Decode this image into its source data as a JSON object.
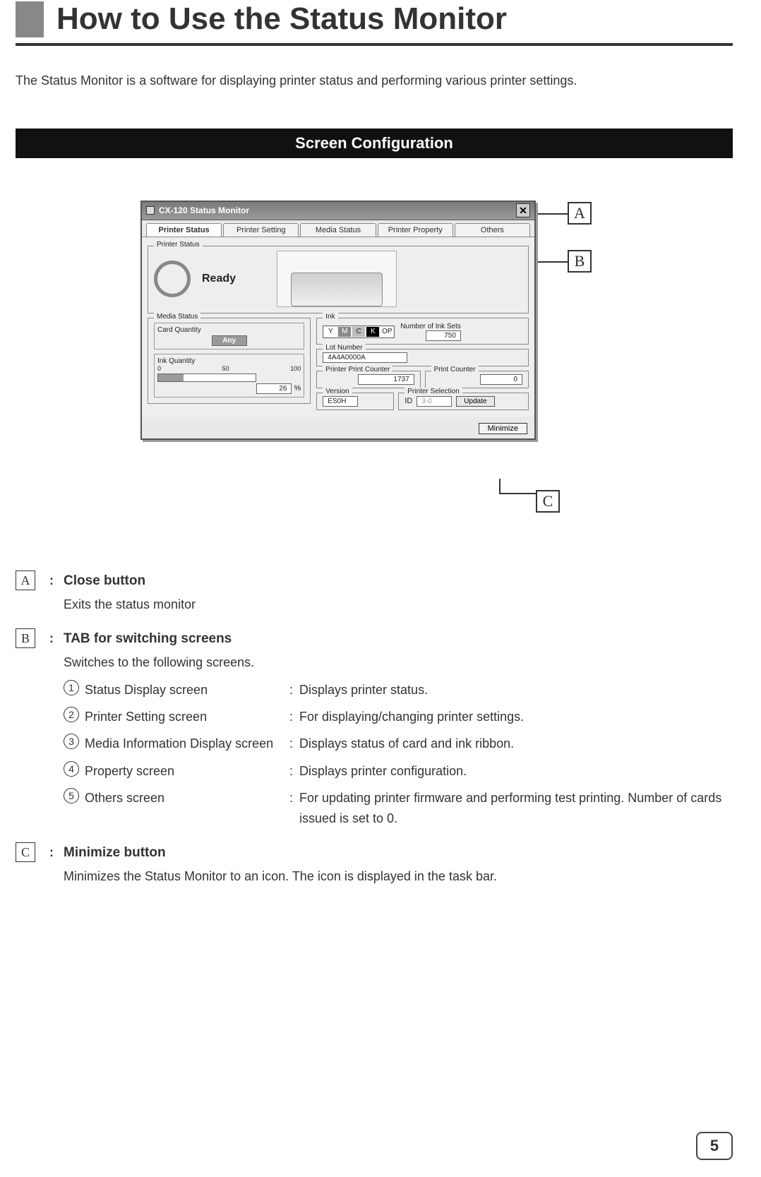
{
  "page_title": "How to Use the Status Monitor",
  "intro": "The Status Monitor is a software for displaying printer status and performing various printer settings.",
  "section_head": "Screen Configuration",
  "app": {
    "window_title": "CX-120 Status Monitor",
    "close_glyph": "✕",
    "tabs": {
      "t1": "Printer Status",
      "t2": "Printer Setting",
      "t3": "Media Status",
      "t4": "Printer Property",
      "t5": "Others"
    },
    "printer_status_group": "Printer Status",
    "ready": "Ready",
    "media_status_group": "Media Status",
    "card_qty_label": "Card Quantity",
    "card_qty_value": "Any",
    "ink_qty_label": "Ink Quantity",
    "scale0": "0",
    "scale50": "50",
    "scale100": "100",
    "ink_pct": "26",
    "pct_sign": "%",
    "ink_group": "Ink",
    "ink_y": "Y",
    "ink_m": "M",
    "ink_c": "C",
    "ink_k": "K",
    "ink_op": "OP",
    "num_ink_sets_label": "Number of Ink Sets",
    "num_ink_sets_value": "750",
    "lot_label": "Lot Number",
    "lot_value": "4A4A0000A",
    "ppc_label": "Printer Print Counter",
    "ppc_value": "1737",
    "pc_label": "Print Counter",
    "pc_value": "0",
    "version_label": "Version",
    "version_value": "ES0H",
    "psel_label": "Printer Selection",
    "psel_id": "ID",
    "psel_value": "3-0",
    "update_btn": "Update",
    "minimize_btn": "Minimize"
  },
  "callouts": {
    "a": "A",
    "b": "B",
    "c": "C"
  },
  "defs": {
    "a_head": "Close button",
    "a_desc": "Exits the status monitor",
    "b_head": "TAB for switching screens",
    "b_desc": "Switches to the following screens.",
    "b_items": {
      "n1": "1",
      "t1": "Status Display screen",
      "d1": "Displays printer status.",
      "n2": "2",
      "t2": "Printer Setting screen",
      "d2": "For displaying/changing printer settings.",
      "n3": "3",
      "t3": "Media Information Display screen",
      "d3": "Displays status of card and ink ribbon.",
      "n4": "4",
      "t4": "Property screen",
      "d4": "Displays printer configuration.",
      "n5": "5",
      "t5": "Others screen",
      "d5": "For updating printer firmware and performing test printing. Number of cards issued is set to 0."
    },
    "c_head": "Minimize button",
    "c_desc": "Minimizes the Status Monitor to an icon. The icon is displayed in the task bar."
  },
  "colon": ":",
  "page_number": "5"
}
